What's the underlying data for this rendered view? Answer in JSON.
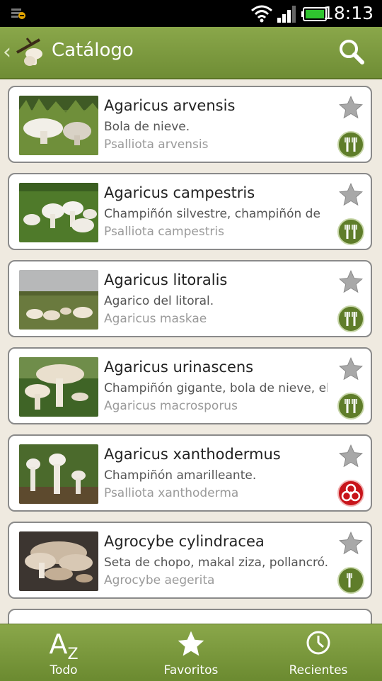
{
  "status_bar": {
    "time": "18:13"
  },
  "action_bar": {
    "title": "Catálogo",
    "back_glyph": "‹",
    "search_icon": "search-icon"
  },
  "items": [
    {
      "name": "Agaricus arvensis",
      "common": "Bola de nieve.",
      "synonym": "Psalliota arvensis",
      "edibility": "edible"
    },
    {
      "name": "Agaricus campestris",
      "common": "Champiñón silvestre, champiñón de",
      "synonym": "Psalliota campestris",
      "edibility": "edible"
    },
    {
      "name": "Agaricus litoralis",
      "common": "Agarico del litoral.",
      "synonym": "Agaricus maskae",
      "edibility": "edible"
    },
    {
      "name": "Agaricus urinascens",
      "common": "Champiñón gigante, bola de nieve, elur",
      "synonym": "Agaricus macrosporus",
      "edibility": "edible"
    },
    {
      "name": "Agaricus xanthodermus",
      "common": "Champiñón amarilleante.",
      "synonym": "Psalliota xanthoderma",
      "edibility": "toxic"
    },
    {
      "name": "Agrocybe cylindracea",
      "common": "Seta de chopo, makal ziza, pollancró.",
      "synonym": "Agrocybe aegerita",
      "edibility": "edible-single"
    }
  ],
  "tabs": [
    {
      "label": "Todo",
      "icon": "az-icon",
      "glyph": "A",
      "glyph_sub": "Z"
    },
    {
      "label": "Favoritos",
      "icon": "star-icon"
    },
    {
      "label": "Recientes",
      "icon": "clock-icon"
    }
  ],
  "colors": {
    "accent": "#7c9a3d",
    "edible": "#5f7d2a",
    "toxic": "#c8141a"
  }
}
